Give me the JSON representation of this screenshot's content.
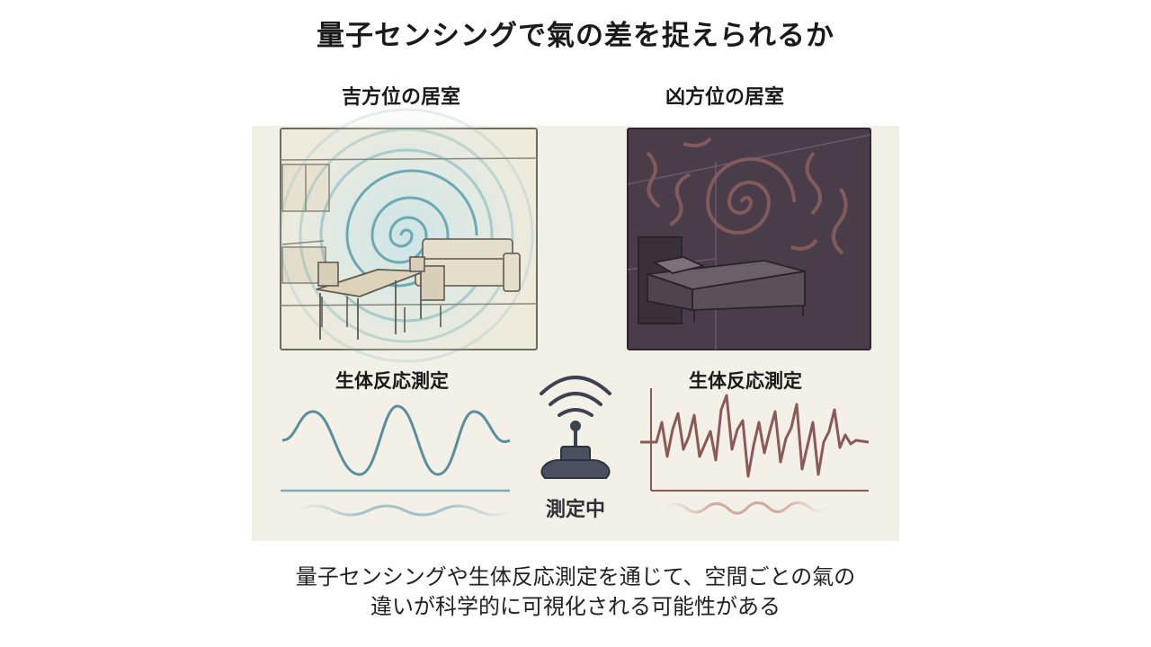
{
  "title": "量子センシングで氣の差を捉えられるか",
  "rooms": {
    "good": {
      "label": "吉方位の居室",
      "bio_label": "生体反応測定"
    },
    "bad": {
      "label": "凶方位の居室",
      "bio_label": "生体反応測定"
    }
  },
  "device": {
    "status_label": "測定中",
    "icon": "wireless-sensor-icon"
  },
  "caption": {
    "line1": "量子センシングや生体反応測定を通じて、空間ごとの氣の",
    "line2": "違いが科学的に可視化される可能性がある"
  },
  "colors": {
    "good_wave": "#5a8e9c",
    "bad_wave": "#8a5a58",
    "bad_room_bg": "#4a3d4a",
    "panel_bg": "#f3f0e7"
  }
}
